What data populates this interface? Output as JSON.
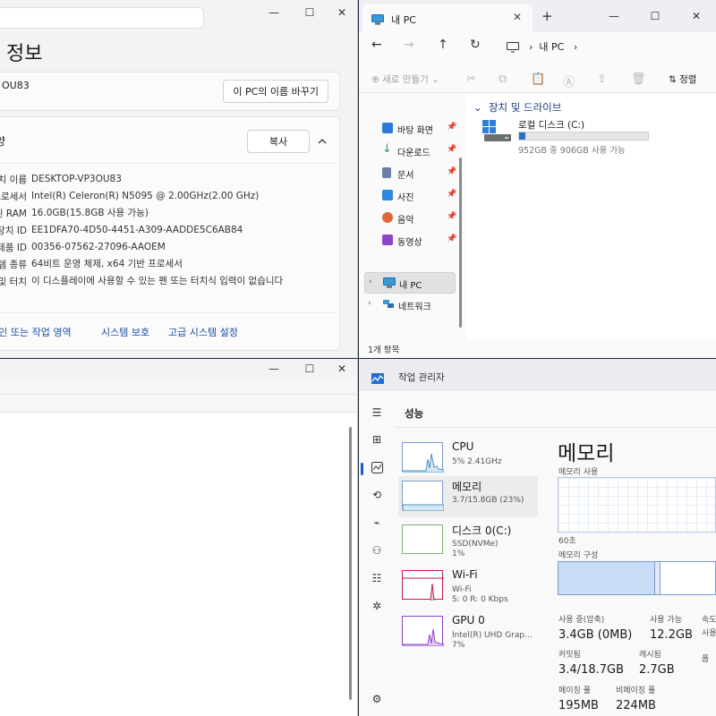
{
  "system_info": {
    "title": "정보",
    "pc_name_short": "OU83",
    "rename_button": "이 PC의 이름 바꾸기",
    "section_title": "사양",
    "copy_button": "복사",
    "specs": [
      {
        "key": "장치 이름",
        "value": "DESKTOP-VP3OU83"
      },
      {
        "key": "프로세서",
        "value": "Intel(R) Celeron(R) N5095 @ 2.00GHz(2.00 GHz)"
      },
      {
        "key": "설치된 RAM",
        "value": "16.0GB(15.8GB 사용 가능)"
      },
      {
        "key": "장치 ID",
        "value": "EE1DFA70-4D50-4451-A309-AADDE5C6AB84"
      },
      {
        "key": "제품 ID",
        "value": "00356-07562-27096-AAOEM"
      },
      {
        "key": "시스템 종류",
        "value": "64비트 운영 체제, x64 기반 프로세서"
      },
      {
        "key": "펜 및 터치",
        "value": "이 디스플레이에 사용할 수 있는 펜 또는 터치식 입력이 없습니다"
      }
    ],
    "links": [
      "도메인 또는 작업 영역",
      "시스템 보호",
      "고급 시스템 설정"
    ]
  },
  "explorer": {
    "tab_title": "내 PC",
    "address": "내 PC",
    "new_button": "새로 만들기",
    "sort_button": "정렬",
    "quick_access": [
      {
        "label": "바탕 화면",
        "icon": "desktop-icon",
        "color": "#2b7bd6"
      },
      {
        "label": "다운로드",
        "icon": "download-icon",
        "color": "#1f9e6e"
      },
      {
        "label": "문서",
        "icon": "document-icon",
        "color": "#6b7fa8"
      },
      {
        "label": "사진",
        "icon": "pictures-icon",
        "color": "#2e86de"
      },
      {
        "label": "음악",
        "icon": "music-icon",
        "color": "#e0663a"
      },
      {
        "label": "동영상",
        "icon": "video-icon",
        "color": "#8e44c9"
      }
    ],
    "tree": [
      {
        "label": "내 PC",
        "icon": "pc-icon"
      },
      {
        "label": "네트워크",
        "icon": "network-icon"
      }
    ],
    "section_title": "장치 및 드라이브",
    "drive": {
      "name": "로컬 디스크 (C:)",
      "free_text": "952GB 중 906GB 사용 가능",
      "used_fraction": 0.048
    },
    "status": "1개 항목"
  },
  "task_manager": {
    "title": "작업 관리자",
    "section": "성능",
    "items": [
      {
        "name": "CPU",
        "sub1": "5% 2.41GHz",
        "sub2": "",
        "color": "#4a90c2"
      },
      {
        "name": "메모리",
        "sub1": "3.7/15.8GB (23%)",
        "sub2": "",
        "color": "#4a90c2"
      },
      {
        "name": "디스크 0(C:)",
        "sub1": "SSD(NVMe)",
        "sub2": "1%",
        "color": "#5aa04a"
      },
      {
        "name": "Wi-Fi",
        "sub1": "Wi-Fi",
        "sub2": "S: 0 R: 0 Kbps",
        "color": "#c2185b"
      },
      {
        "name": "GPU 0",
        "sub1": "Intel(R) UHD Grap...",
        "sub2": "7%",
        "color": "#8e44c9"
      }
    ],
    "mem_title": "메모리",
    "usage_label": "메모리 사용",
    "time_label": "60초",
    "composition_label": "메모리 구성",
    "stats": [
      {
        "label": "사용 중(압축)",
        "value": "3.4GB (0MB)"
      },
      {
        "label": "사용 가능",
        "value": "12.2GB"
      },
      {
        "label": "속도",
        "value": ""
      },
      {
        "label": "커밋됨",
        "value": "3.4/18.7GB"
      },
      {
        "label": "캐시됨",
        "value": "2.7GB"
      },
      {
        "label": "페이징 풀",
        "value": "195MB"
      },
      {
        "label": "비페이징 풀",
        "value": "224MB"
      }
    ],
    "side_labels": [
      "속도",
      "사용",
      "폼"
    ]
  }
}
